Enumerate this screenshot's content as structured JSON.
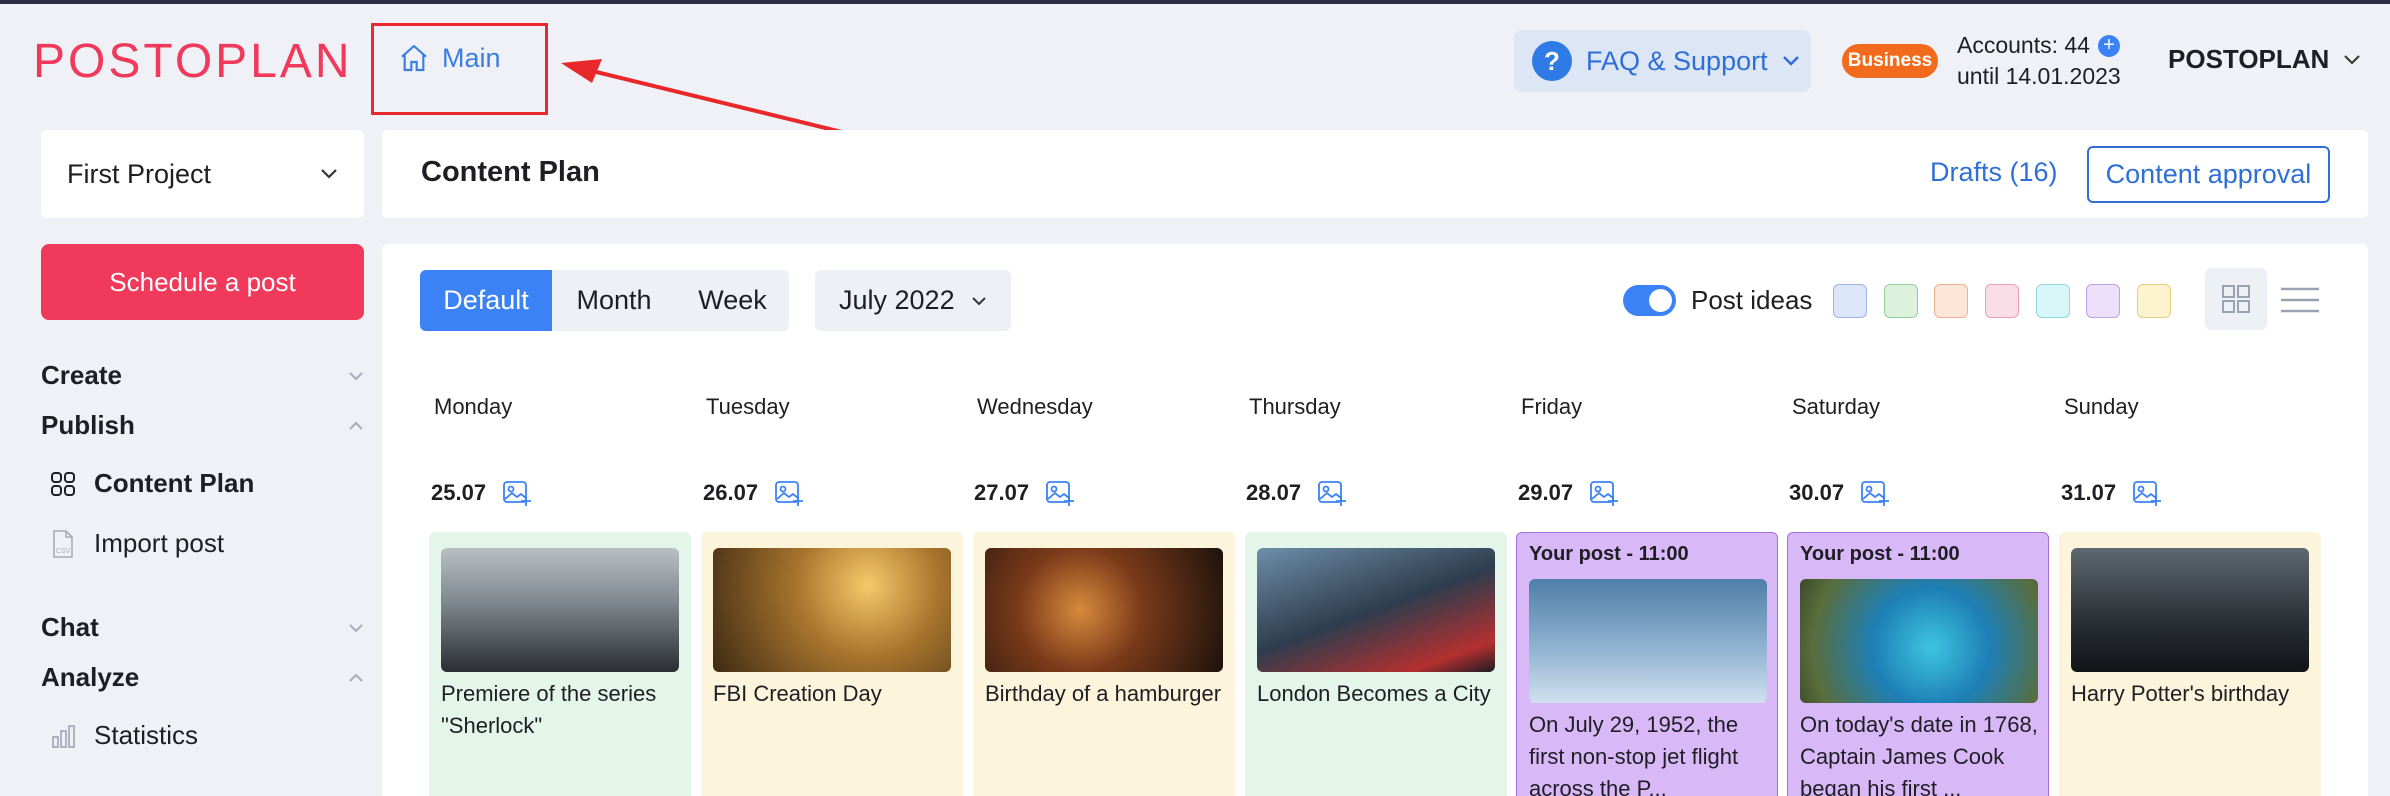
{
  "brand": {
    "logo_text": "POSTOPLAN"
  },
  "nav": {
    "main_label": "Main"
  },
  "header": {
    "faq_label": "FAQ & Support",
    "plan_badge": "Business",
    "accounts_label": "Accounts: 44",
    "accounts_until": "until 14.01.2023",
    "user_name": "POSTOPLAN"
  },
  "sidebar": {
    "project": "First Project",
    "schedule_button": "Schedule a post",
    "sections": [
      {
        "label": "Create",
        "expanded": false
      },
      {
        "label": "Publish",
        "expanded": true
      },
      {
        "label": "Chat",
        "expanded": false
      },
      {
        "label": "Analyze",
        "expanded": true
      }
    ],
    "items": [
      {
        "label": "Content Plan",
        "active": true
      },
      {
        "label": "Import post",
        "active": false
      },
      {
        "label": "Statistics",
        "active": false
      }
    ]
  },
  "content": {
    "title": "Content Plan",
    "drafts_label": "Drafts (16)",
    "approval_label": "Content approval"
  },
  "toolbar": {
    "views": [
      "Default",
      "Month",
      "Week"
    ],
    "active_view": "Default",
    "period": "July 2022",
    "post_ideas_label": "Post ideas",
    "post_ideas_on": true,
    "swatch_colors": [
      "#dce6fb",
      "#dcf2df",
      "#fde5d8",
      "#fbdde7",
      "#d9f6f8",
      "#ece0fa",
      "#fdf3cf"
    ]
  },
  "calendar": {
    "days": [
      {
        "name": "Monday",
        "date": "25.07"
      },
      {
        "name": "Tuesday",
        "date": "26.07"
      },
      {
        "name": "Wednesday",
        "date": "27.07"
      },
      {
        "name": "Thursday",
        "date": "28.07"
      },
      {
        "name": "Friday",
        "date": "29.07"
      },
      {
        "name": "Saturday",
        "date": "30.07"
      },
      {
        "name": "Sunday",
        "date": "31.07"
      }
    ],
    "cards": [
      {
        "type": "idea",
        "caption": "Premiere of the series \"Sherlock\"",
        "bg": "#e4f5ea"
      },
      {
        "type": "idea",
        "caption": "FBI Creation Day",
        "bg": "#fdf4dc"
      },
      {
        "type": "idea",
        "caption": "Birthday of a hamburger",
        "bg": "#fdf4dc"
      },
      {
        "type": "idea",
        "caption": "London Becomes a City",
        "bg": "#e4f5ea"
      },
      {
        "type": "post",
        "header": "Your post - 11:00",
        "caption": "On July 29, 1952, the first non-stop jet flight across the P...",
        "bg": "#d8b8f7"
      },
      {
        "type": "post",
        "header": "Your post - 11:00",
        "caption": "On today's date in 1768, Captain James Cook began his first ...",
        "bg": "#d8b8f7"
      },
      {
        "type": "idea",
        "caption": "Harry Potter's birthday",
        "bg": "#fdf4dc"
      }
    ]
  }
}
